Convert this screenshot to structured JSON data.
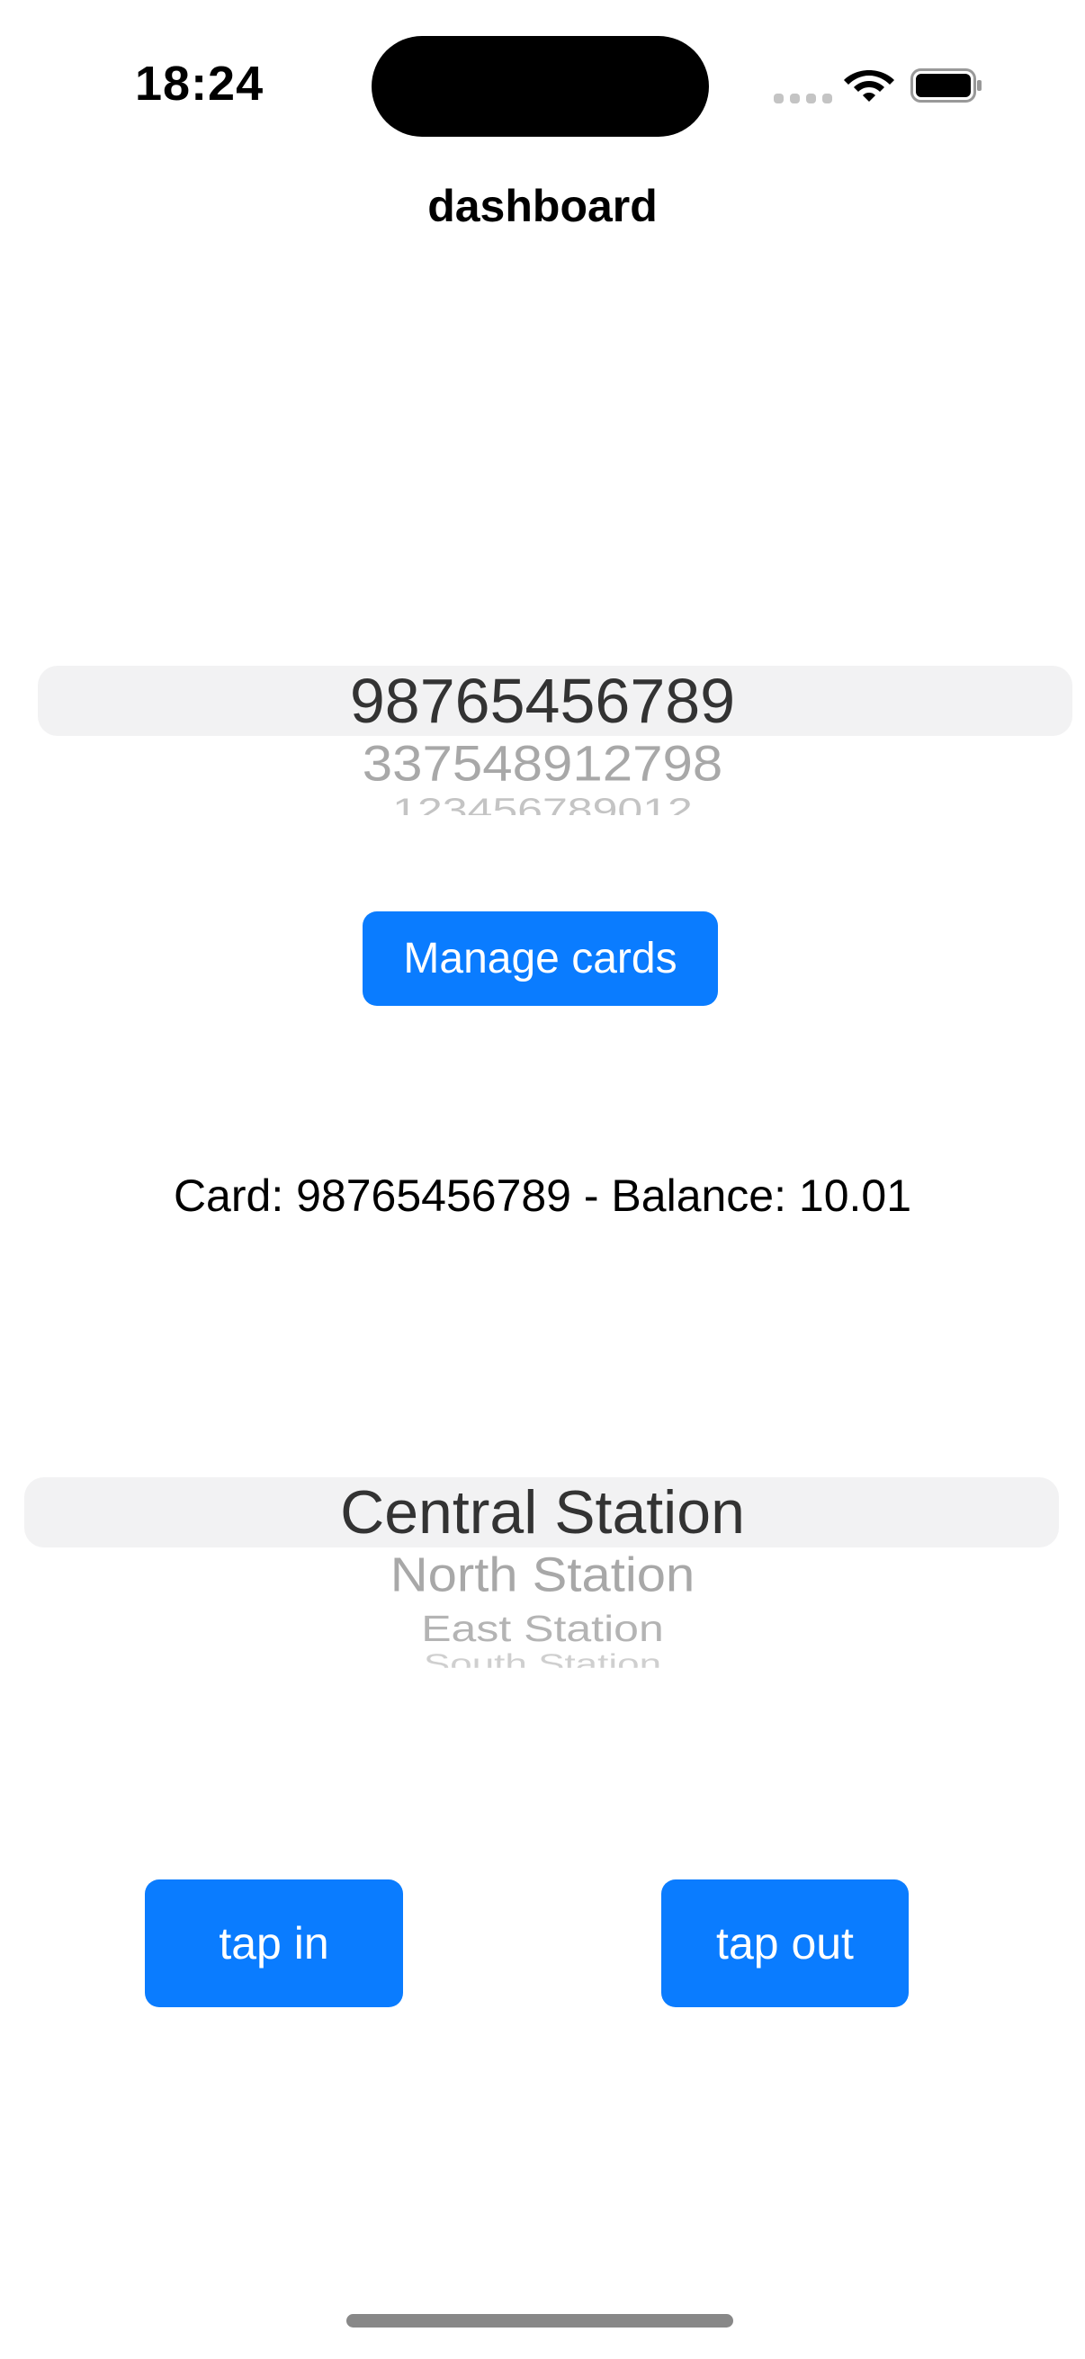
{
  "status_bar": {
    "time": "18:24",
    "icons": [
      "cellular-signal-icon",
      "wifi-icon",
      "battery-icon"
    ]
  },
  "nav": {
    "title": "dashboard"
  },
  "card_picker": {
    "selected": "98765456789",
    "options": [
      "98765456789",
      "337548912798",
      "123456789012"
    ]
  },
  "manage_cards": {
    "label": "Manage cards"
  },
  "balance": {
    "text": "Card: 98765456789 - Balance: 10.01"
  },
  "station_picker": {
    "selected": "Central Station",
    "options": [
      "Central Station",
      "North Station",
      "East Station",
      "South Station"
    ]
  },
  "actions": {
    "tap_in_label": "tap in",
    "tap_out_label": "tap out"
  },
  "colors": {
    "accent": "#0a7cff",
    "picker_highlight": "#f2f2f3",
    "background": "#ffffff"
  }
}
